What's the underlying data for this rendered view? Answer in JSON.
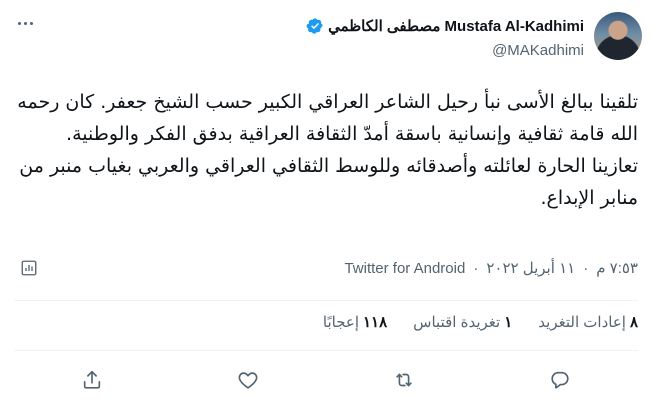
{
  "author": {
    "display_name": "Mustafa Al-Kadhimi مصطفى الكاظمي",
    "handle": "@MAKadhimi",
    "verified": true
  },
  "tweet": {
    "paragraph_1": "تلقينا ببالغ الأسى نبأ رحيل الشاعر العراقي الكبير حسب الشيخ جعفر. كان رحمه الله قامة ثقافية وإنسانية باسقة أمدّ الثقافة العراقية بدفق الفكر والوطنية.",
    "paragraph_2": "تعازينا الحارة لعائلته وأصدقائه وللوسط الثقافي العراقي والعربي بغياب منبر من منابر الإبداع."
  },
  "meta": {
    "time": "٧:٥٣ م",
    "separator": "·",
    "date": "١١ أبريل ٢٠٢٢",
    "source": "Twitter for Android"
  },
  "stats": {
    "retweets_count": "٨",
    "retweets_label": "إعادات التغريد",
    "quotes_count": "١",
    "quotes_label": "تغريدة اقتباس",
    "likes_count": "١١٨",
    "likes_label": "إعجابًا"
  },
  "icons": {
    "verified": "verified-badge-icon",
    "more": "more-icon",
    "analytics": "analytics-icon",
    "reply": "reply-icon",
    "retweet": "retweet-icon",
    "like": "like-icon",
    "share": "share-icon"
  },
  "colors": {
    "text": "#0f1419",
    "secondary": "#536471",
    "verified": "#1d9bf0",
    "divider": "#eff3f4"
  }
}
